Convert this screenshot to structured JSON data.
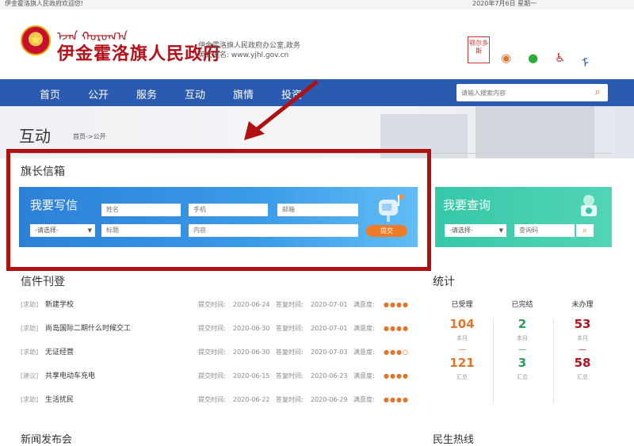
{
  "topbar": {
    "welcome": "伊金霍洛旗人民政府欢迎您!",
    "date": "2020年7月6日 星期一"
  },
  "header": {
    "mongolian": "ᠡᠵᠡᠨ ᠬᠣᠷᠣᠭ᠎ᠠ",
    "title": "伊金霍洛旗人民政府",
    "office_line": "伊金霍洛旗人民政府办公室,政务",
    "domain_line": "英文域名: www.yjhl.gov.cn",
    "seal_text": "鄂尔多斯"
  },
  "nav": {
    "items": [
      "首页",
      "公开",
      "服务",
      "互动",
      "旗情",
      "投资"
    ],
    "search_placeholder": "请输入搜索内容"
  },
  "page": {
    "title": "互动",
    "breadcrumb": "首页->公开"
  },
  "mailbox": {
    "section_title": "旗长信箱",
    "write_label": "我要写信",
    "name_ph": "姓名",
    "phone_ph": "手机",
    "email_ph": "邮箱",
    "select_label": "-请选择-",
    "subject_ph": "标题",
    "content_ph": "内容",
    "submit_label": "提交",
    "query_label": "我要查询",
    "query_select": "-请选择-",
    "query_code_ph": "查询码"
  },
  "letters": {
    "title": "信件刊登",
    "submit_prefix": "提交时间: ",
    "reply_prefix": "答复时间: ",
    "satisfaction_label": "满意度: ",
    "rows": [
      {
        "tag": "[求助]",
        "title": "新建学校",
        "submit": "2020-06-24",
        "reply": "2020-07-01",
        "sat": "●●●●"
      },
      {
        "tag": "[求助]",
        "title": "尚岛国际二期什么时候交工",
        "submit": "2020-06-30",
        "reply": "2020-07-01",
        "sat": "●●●●"
      },
      {
        "tag": "[求助]",
        "title": "无证经营",
        "submit": "2020-06-30",
        "reply": "2020-07-03",
        "sat": "●●●○"
      },
      {
        "tag": "[建议]",
        "title": "共享电动车充电",
        "submit": "2020-06-15",
        "reply": "2020-06-23",
        "sat": "●●●●"
      },
      {
        "tag": "[求助]",
        "title": "生活扰民",
        "submit": "2020-06-22",
        "reply": "2020-06-29",
        "sat": "●●●●"
      }
    ]
  },
  "stats": {
    "title": "统计",
    "columns": [
      {
        "header": "已受理",
        "month": "104",
        "month_unit": "本月",
        "dash": "—",
        "total": "121",
        "total_unit": "汇总",
        "color": "#e2752b"
      },
      {
        "header": "已完结",
        "month": "2",
        "month_unit": "本月",
        "dash": "—",
        "total": "3",
        "total_unit": "汇总",
        "color": "#2a9d5c"
      },
      {
        "header": "未办理",
        "month": "53",
        "month_unit": "本月",
        "dash": "—",
        "total": "58",
        "total_unit": "汇总",
        "color": "#b5121b"
      }
    ]
  },
  "bottom": {
    "left": "新闻发布会",
    "right": "民生热线"
  }
}
